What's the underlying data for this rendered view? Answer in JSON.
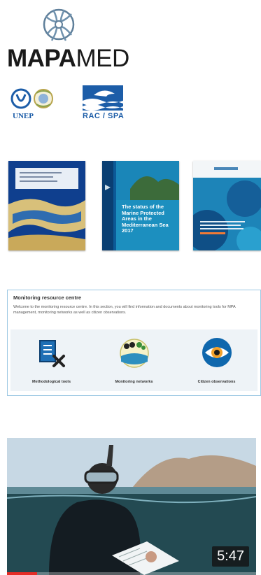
{
  "brand": {
    "name_bold": "MAPA",
    "name_light": "MED"
  },
  "partners": {
    "unep": "UNEP",
    "racspa": "RAC / SPA"
  },
  "colors": {
    "brand_blue": "#1c5da8",
    "panel_border": "#9cc8e3",
    "accent_red": "#e52d27"
  },
  "publications": [
    {
      "title": ""
    },
    {
      "title": "The status of the Marine Protected Areas in the Mediterranean Sea 2017"
    },
    {
      "title": ""
    }
  ],
  "monitoring": {
    "title": "Monitoring resource centre",
    "description": "Welcome to the monitoring resource centre. In this section, you will find information and documents about monitoring tools for MPA management, monitoring networks as well as citizen observations.",
    "tiles": [
      {
        "label": "Methodological tools",
        "icon": "tools-icon"
      },
      {
        "label": "Monitoring networks",
        "icon": "network-icon"
      },
      {
        "label": "Citizen observations",
        "icon": "eye-icon"
      }
    ]
  },
  "video": {
    "duration": "5:47",
    "progress": 0.12
  }
}
